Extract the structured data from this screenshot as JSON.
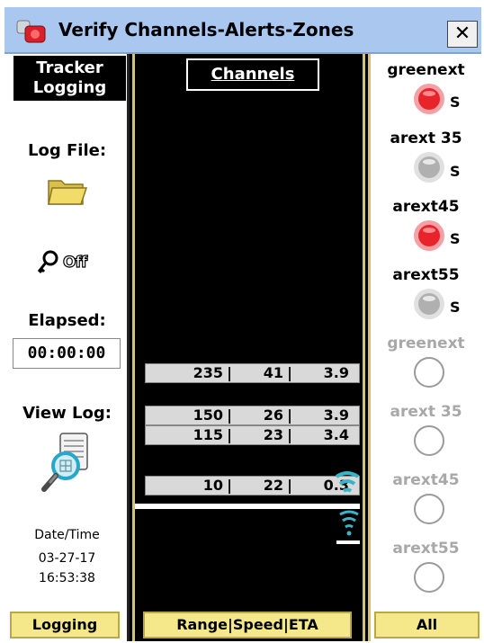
{
  "window": {
    "title": "Verify Channels-Alerts-Zones",
    "close_label": "✕"
  },
  "left": {
    "header": "Tracker Logging",
    "log_file_label": "Log File:",
    "logging_state": "Off",
    "elapsed_label": "Elapsed:",
    "elapsed_value": "00:00:00",
    "view_log_label": "View Log:",
    "datetime_label": "Date/Time",
    "date": "03-27-17",
    "time": "16:53:38",
    "tab_label": "Logging"
  },
  "middle": {
    "channels_button": "Channels",
    "rows": [
      {
        "range": "235",
        "speed": "41",
        "eta": "3.9"
      },
      {
        "range": "150",
        "speed": "26",
        "eta": "3.9"
      },
      {
        "range": "115",
        "speed": "23",
        "eta": "3.4"
      },
      {
        "range": "10",
        "speed": "22",
        "eta": "0.3"
      }
    ],
    "tab_label": "Range|Speed|ETA"
  },
  "right": {
    "zones": [
      {
        "name": "greenext",
        "state": "red",
        "suffix": "S",
        "active": true
      },
      {
        "name": "arext 35",
        "state": "gray",
        "suffix": "S",
        "active": true
      },
      {
        "name": "arext45",
        "state": "red",
        "suffix": "S",
        "active": true
      },
      {
        "name": "arext55",
        "state": "gray",
        "suffix": "S",
        "active": true
      },
      {
        "name": "greenext",
        "state": "empty",
        "suffix": "",
        "active": false
      },
      {
        "name": "arext 35",
        "state": "empty",
        "suffix": "",
        "active": false
      },
      {
        "name": "arext45",
        "state": "empty",
        "suffix": "",
        "active": false
      },
      {
        "name": "arext55",
        "state": "empty",
        "suffix": "",
        "active": false
      }
    ],
    "tab_label": "All"
  },
  "colors": {
    "titlebar": "#a9c7ef",
    "tab_fill": "#f5e88a",
    "led_red": "#e8232a",
    "led_gray": "#b0b0b0",
    "accent_border": "#d6c26a"
  },
  "icons": {
    "app": "app-icon",
    "folder": "folder-icon",
    "key": "key-icon",
    "view_log": "magnifier-document-icon",
    "signal": "wireless-signal-icon"
  }
}
